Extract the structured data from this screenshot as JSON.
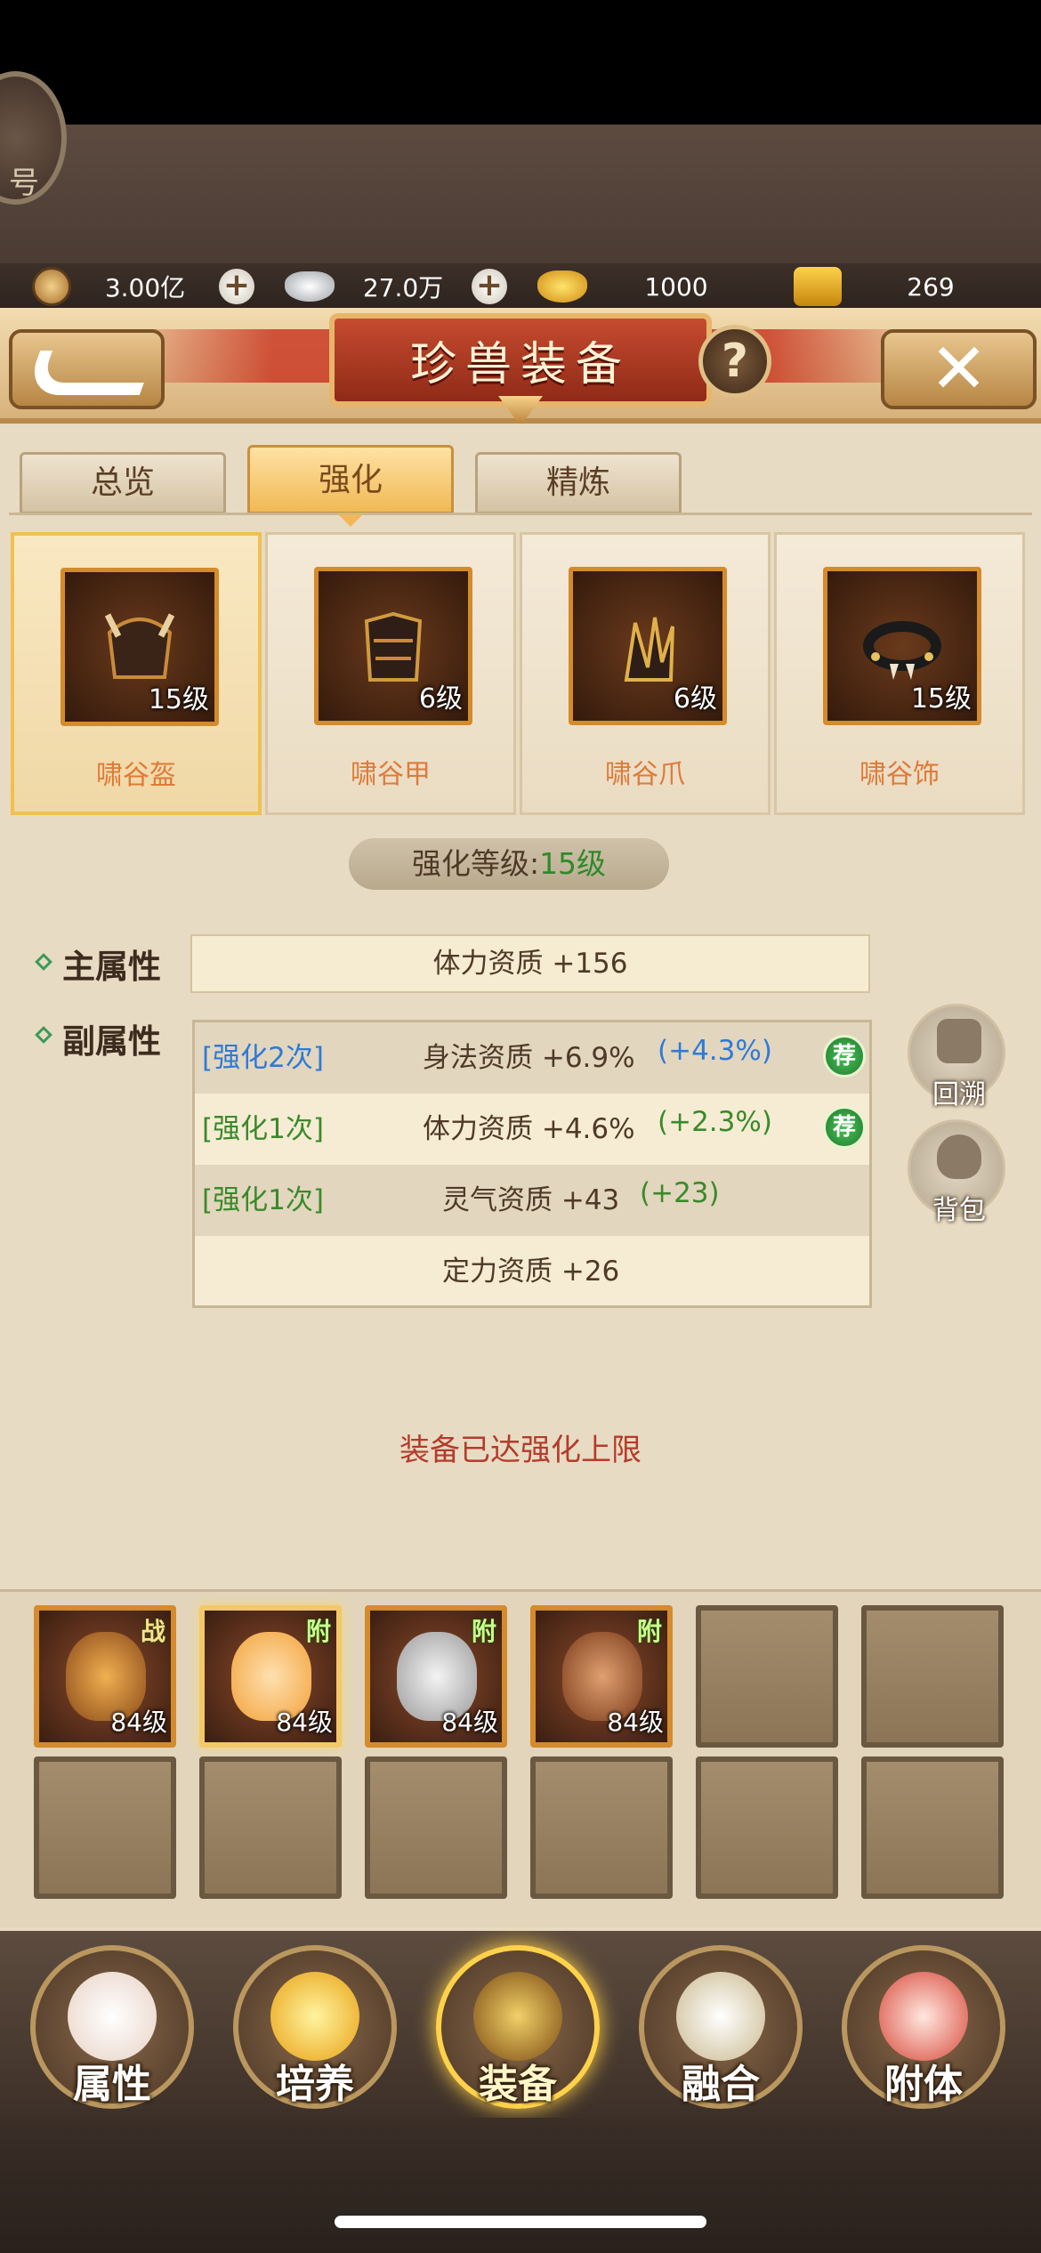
{
  "account": {
    "avatar_label": "号"
  },
  "currencies": [
    {
      "icon": "copper-coin-icon",
      "value": "3.00亿"
    },
    {
      "icon": "silver-ingot-icon",
      "value": "27.0万"
    },
    {
      "icon": "gold-ingot-icon",
      "value": "1000"
    },
    {
      "icon": "locked-gold-icon",
      "value": "269"
    }
  ],
  "header": {
    "title": "珍兽装备",
    "help_label": "?",
    "close_label": "✕"
  },
  "tabs": [
    {
      "label": "总览",
      "active": false
    },
    {
      "label": "强化",
      "active": true
    },
    {
      "label": "精炼",
      "active": false
    }
  ],
  "equipment": [
    {
      "name": "啸谷盔",
      "level": "15级",
      "selected": true
    },
    {
      "name": "啸谷甲",
      "level": "6级",
      "selected": false
    },
    {
      "name": "啸谷爪",
      "level": "6级",
      "selected": false
    },
    {
      "name": "啸谷饰",
      "level": "15级",
      "selected": false
    }
  ],
  "enhance": {
    "label": "强化等级:",
    "value": "15级"
  },
  "main_attr": {
    "label": "主属性",
    "value": "体力资质  +156"
  },
  "sub_attr": {
    "label": "副属性",
    "rows": [
      {
        "tag": "[强化2次]",
        "attr": "身法资质  +6.9%",
        "bonus": "(+4.3%)",
        "saved": "荐"
      },
      {
        "tag": "[强化1次]",
        "attr": "体力资质  +4.6%",
        "bonus": "(+2.3%)",
        "saved": "荐"
      },
      {
        "tag": "[强化1次]",
        "attr": "灵气资质  +43",
        "bonus": "(+23)",
        "saved": ""
      },
      {
        "tag": "",
        "attr": "定力资质  +26",
        "bonus": "",
        "saved": ""
      }
    ]
  },
  "side_buttons": [
    {
      "label": "回溯",
      "icon": "rewind-icon"
    },
    {
      "label": "背包",
      "icon": "bag-icon"
    }
  ],
  "max_message": "装备已达强化上限",
  "pets": [
    {
      "level": "84级",
      "tag": "战",
      "filled": true,
      "selected": false,
      "color": "#c98a3a"
    },
    {
      "level": "84级",
      "tag": "附",
      "filled": true,
      "selected": true,
      "color": "#f2a23a"
    },
    {
      "level": "84级",
      "tag": "附",
      "filled": true,
      "selected": false,
      "color": "#d9d9d9"
    },
    {
      "level": "84级",
      "tag": "附",
      "filled": true,
      "selected": false,
      "color": "#b86a32"
    }
  ],
  "bottom_nav": [
    {
      "label": "属性",
      "active": false,
      "color": "#f2e6dc"
    },
    {
      "label": "培养",
      "active": false,
      "color": "#f6c83a"
    },
    {
      "label": "装备",
      "active": true,
      "color": "#d4a22a"
    },
    {
      "label": "融合",
      "active": false,
      "color": "#e8dcc0"
    },
    {
      "label": "附体",
      "active": false,
      "color": "#e86a5a"
    }
  ],
  "colors": {
    "accent_orange": "#e07a38",
    "tab_active": "#f0b955",
    "warning_red": "#b53b2b",
    "green": "#3a8a2a",
    "blue": "#2f7ad6"
  }
}
